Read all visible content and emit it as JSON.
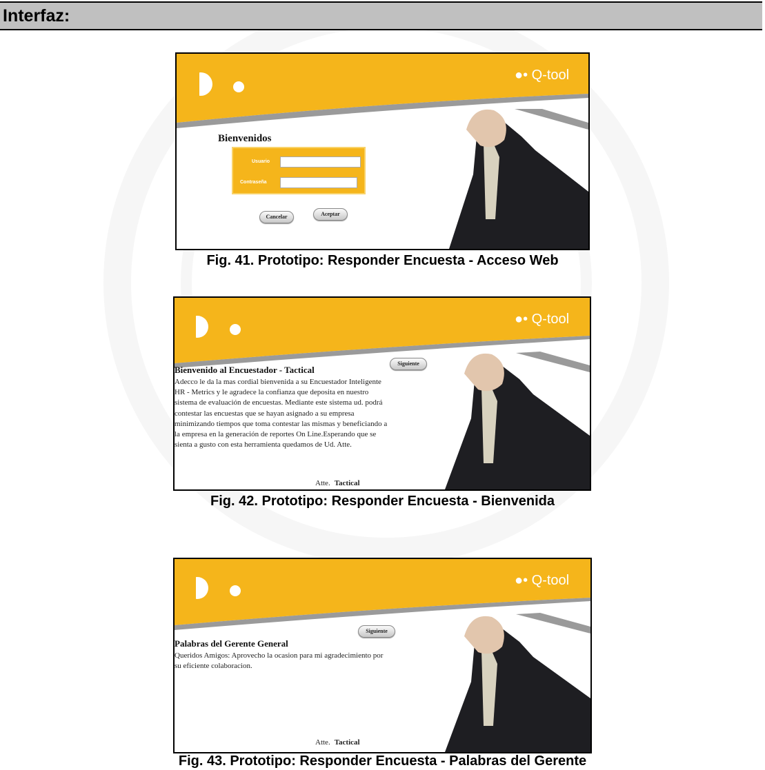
{
  "section": {
    "title": "Interfaz:"
  },
  "brand": {
    "logo_text": "Q-tool"
  },
  "figures": [
    {
      "caption": "Fig. 41. Prototipo: Responder Encuesta - Acceso Web",
      "welcome": "Bienvenidos",
      "user_label": "Usuario",
      "password_label": "Contraseña",
      "cancel_label": "Cancelar",
      "accept_label": "Aceptar"
    },
    {
      "caption": "Fig. 42. Prototipo: Responder Encuesta - Bienvenida",
      "title": "Bienvenido al Encuestador - Tactical",
      "next_label": "Siguiente",
      "lines": [
        "Adecco le da la mas cordial bienvenida a su Encuestador Inteligente",
        "HR - Metrics y le agradece la confianza que deposita en nuestro",
        "sistema de evaluación de encuestas. Mediante este sistema ud. podrá",
        "contestar las encuestas que se hayan asignado a su empresa",
        "minimizando tiempos que toma contestar las mismas y beneficiando a",
        "la empresa en la generación de reportes On Line.Esperando que se",
        "sienta a gusto con esta herramienta quedamos de Ud. Atte."
      ],
      "sign_prefix": "Atte.",
      "sign_name": "Tactical"
    },
    {
      "caption": "Fig. 43. Prototipo: Responder Encuesta - Palabras del Gerente",
      "title": "Palabras del Gerente General",
      "next_label": "Siguiente",
      "lines": [
        "Queridos Amigos: Aprovecho la ocasion para mi agradecimiento por",
        "su eficiente colaboracion."
      ],
      "sign_prefix": "Atte.",
      "sign_name": "Tactical"
    }
  ],
  "colors": {
    "accent": "#f5b51b",
    "swoosh": "#9a9a9a",
    "suit": "#1e1e22"
  }
}
